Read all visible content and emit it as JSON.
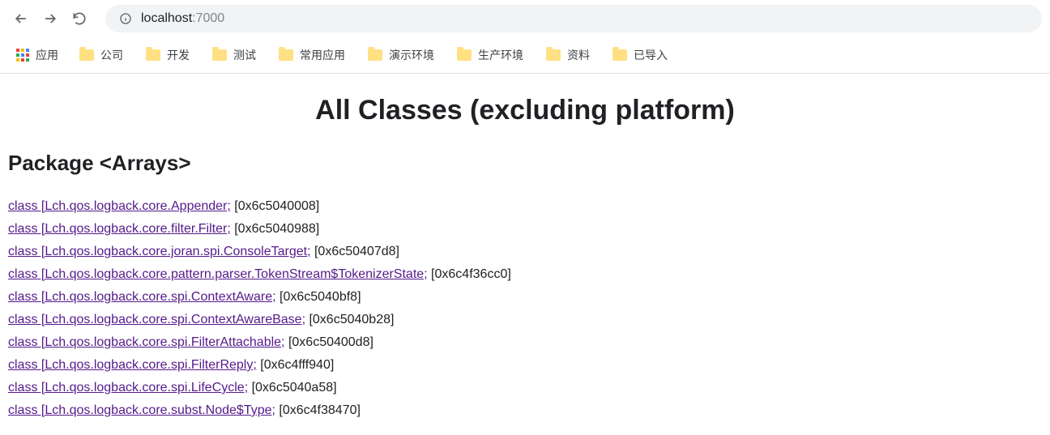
{
  "omnibox": {
    "host": "localhost",
    "port": ":7000"
  },
  "bookmarks": {
    "apps_label": "应用",
    "items": [
      {
        "label": "公司"
      },
      {
        "label": "开发"
      },
      {
        "label": "测试"
      },
      {
        "label": "常用应用"
      },
      {
        "label": "演示环境"
      },
      {
        "label": "生产环境"
      },
      {
        "label": "资料"
      },
      {
        "label": "已导入"
      }
    ]
  },
  "page": {
    "title": "All Classes (excluding platform)",
    "package_heading": "Package <Arrays>",
    "classes": [
      {
        "link": "class [Lch.qos.logback.core.Appender;",
        "hex": " [0x6c5040008]"
      },
      {
        "link": "class [Lch.qos.logback.core.filter.Filter;",
        "hex": " [0x6c5040988]"
      },
      {
        "link": "class [Lch.qos.logback.core.joran.spi.ConsoleTarget;",
        "hex": " [0x6c50407d8]"
      },
      {
        "link": "class [Lch.qos.logback.core.pattern.parser.TokenStream$TokenizerState;",
        "hex": " [0x6c4f36cc0]"
      },
      {
        "link": "class [Lch.qos.logback.core.spi.ContextAware;",
        "hex": " [0x6c5040bf8]"
      },
      {
        "link": "class [Lch.qos.logback.core.spi.ContextAwareBase;",
        "hex": " [0x6c5040b28]"
      },
      {
        "link": "class [Lch.qos.logback.core.spi.FilterAttachable;",
        "hex": " [0x6c50400d8]"
      },
      {
        "link": "class [Lch.qos.logback.core.spi.FilterReply;",
        "hex": " [0x6c4fff940]"
      },
      {
        "link": "class [Lch.qos.logback.core.spi.LifeCycle;",
        "hex": " [0x6c5040a58]"
      },
      {
        "link": "class [Lch.qos.logback.core.subst.Node$Type;",
        "hex": " [0x6c4f38470]"
      }
    ]
  }
}
